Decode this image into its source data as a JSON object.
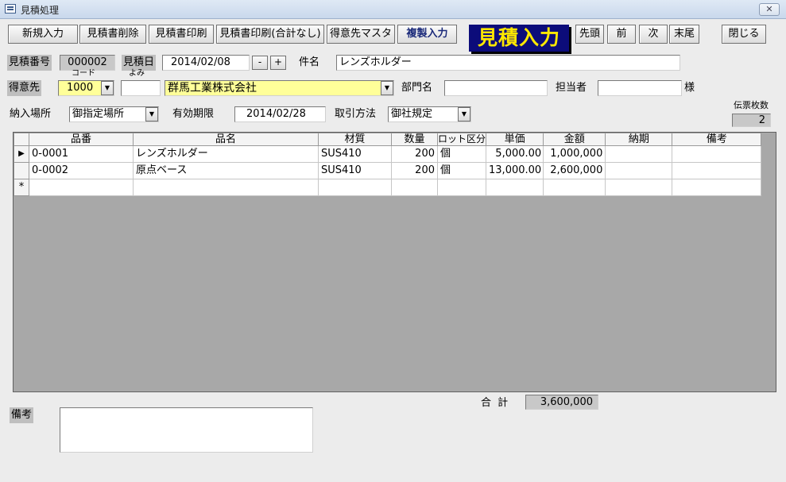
{
  "window": {
    "title": "見積処理",
    "close_glyph": "✕"
  },
  "toolbar": {
    "new_input": "新規入力",
    "delete": "見積書削除",
    "print": "見積書印刷",
    "print_no_total": "見積書印刷(合計なし)",
    "customer_master": "得意先マスタ",
    "copy_input": "複製入力",
    "banner": "見積入力",
    "first": "先頭",
    "prev": "前",
    "next": "次",
    "last": "末尾",
    "close": "閉じる"
  },
  "header": {
    "quote_no_label": "見積番号",
    "quote_no": "000002",
    "quote_date_label": "見積日",
    "quote_date": "2014/02/08",
    "minus": "-",
    "plus": "+",
    "subject_label": "件名",
    "subject": "レンズホルダー",
    "customer_label": "得意先",
    "code_hint": "コード",
    "yomi_hint": "よみ",
    "customer_code": "1000",
    "customer_yomi": "",
    "customer_name": "群馬工業株式会社",
    "dept_label": "部門名",
    "dept": "",
    "person_label": "担当者",
    "person": "",
    "honorific": "様",
    "delivery_place_label": "納入場所",
    "delivery_place": "御指定場所",
    "valid_until_label": "有効期限",
    "valid_until": "2014/02/28",
    "payment_label": "取引方法",
    "payment": "御社規定",
    "slip_count_label": "伝票枚数",
    "slip_count": "2"
  },
  "grid": {
    "columns": [
      "品番",
      "品名",
      "材質",
      "数量",
      "ロット区分",
      "単価",
      "金額",
      "納期",
      "備考"
    ],
    "rows": [
      {
        "selector": "▶",
        "part_no": "0-0001",
        "name": "レンズホルダー",
        "material": "SUS410",
        "qty": "200",
        "lot": "個",
        "unit_price": "5,000.00",
        "amount": "1,000,000",
        "due": "",
        "note": ""
      },
      {
        "selector": "",
        "part_no": "0-0002",
        "name": "原点ベース",
        "material": "SUS410",
        "qty": "200",
        "lot": "個",
        "unit_price": "13,000.00",
        "amount": "2,600,000",
        "due": "",
        "note": ""
      }
    ],
    "new_row_marker": "*"
  },
  "footer": {
    "total_label": "合 計",
    "total": "3,600,000",
    "remarks_label": "備考",
    "remarks": ""
  },
  "icons": {
    "dropdown": "chevron-down-icon",
    "row_selector": "triangle-right-icon"
  }
}
